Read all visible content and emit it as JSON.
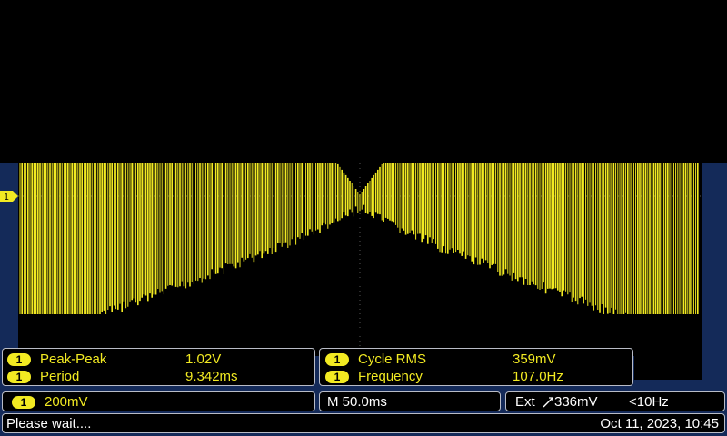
{
  "colors": {
    "trace": "#f2ea22",
    "frame": "#142a59",
    "screen": "#000000",
    "border": "#b9bcc6"
  },
  "channel_marker": "1",
  "measurements": [
    {
      "channel": "1",
      "label": "Peak-Peak",
      "value": "1.02V"
    },
    {
      "channel": "1",
      "label": "Period",
      "value": "9.342ms"
    },
    {
      "channel": "1",
      "label": "Cycle RMS",
      "value": "359mV"
    },
    {
      "channel": "1",
      "label": "Frequency",
      "value": "107.0Hz"
    }
  ],
  "vertical": {
    "channel": "1",
    "scale": "200mV"
  },
  "horizontal": {
    "label": "M 50.0ms"
  },
  "trigger": {
    "source": "Ext",
    "slope_icon": "rising-edge-icon",
    "level": "336mV",
    "freq": "<10Hz"
  },
  "status": {
    "message": "Please wait....",
    "datetime": "Oct 11, 2023, 10:45"
  }
}
